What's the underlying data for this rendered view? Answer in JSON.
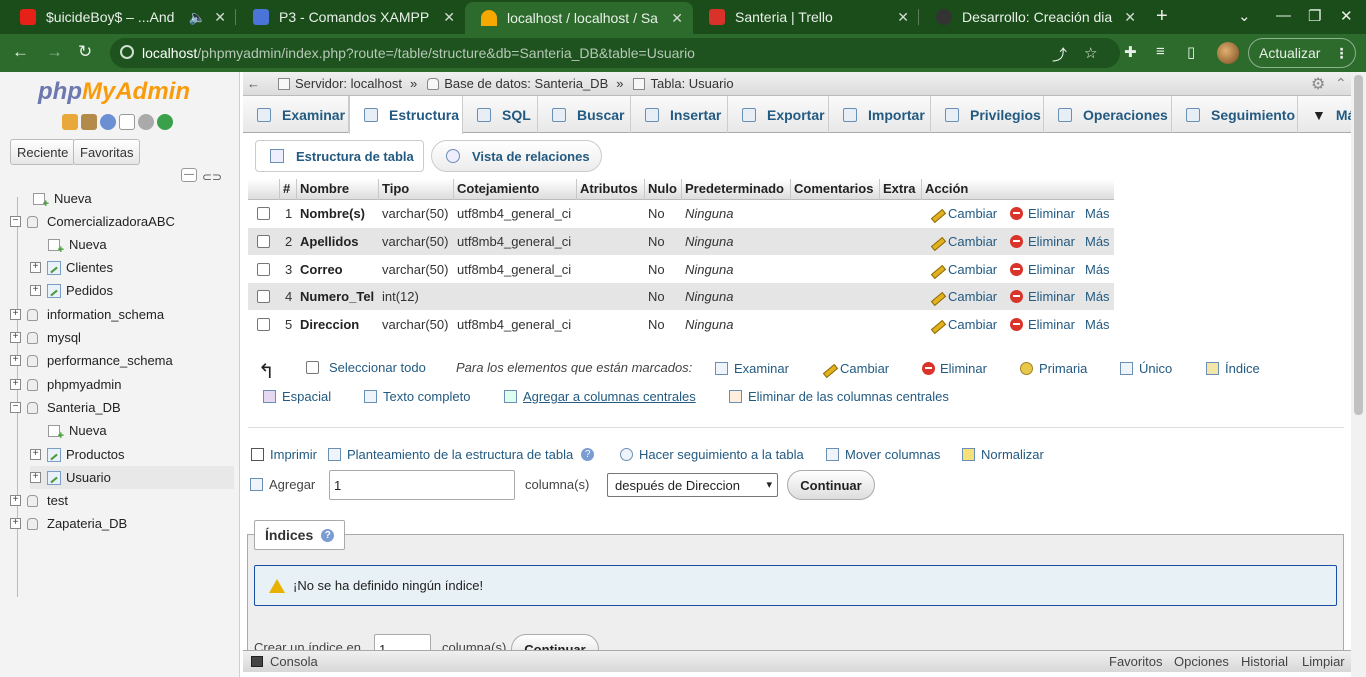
{
  "browser": {
    "tabs": [
      {
        "title": "$uicideBoy$ – ...And",
        "fav_color": "#e62117"
      },
      {
        "title": "P3 - Comandos XAMPP",
        "fav_color": "#4a74d8"
      },
      {
        "title": "localhost / localhost / Sa",
        "fav_color": "#f6a800"
      },
      {
        "title": "Santeria | Trello",
        "fav_color": "#d8322b"
      },
      {
        "title": "Desarrollo: Creación dia",
        "fav_color": "#333333"
      }
    ],
    "url_host": "localhost",
    "url_rest": "/phpmyadmin/index.php?route=/table/structure&db=Santeria_DB&table=Usuario",
    "update_label": "Actualizar"
  },
  "sidebar": {
    "logo_php": "php",
    "logo_myadmin": "MyAdmin",
    "recent_label": "Reciente",
    "favorites_label": "Favoritas",
    "tree": [
      {
        "label": "Nueva",
        "type": "new",
        "level": 0
      },
      {
        "label": "ComercializadoraABC",
        "type": "db",
        "level": 0,
        "expanded": true
      },
      {
        "label": "Nueva",
        "type": "new",
        "level": 1
      },
      {
        "label": "Clientes",
        "type": "table",
        "level": 1
      },
      {
        "label": "Pedidos",
        "type": "table",
        "level": 1
      },
      {
        "label": "information_schema",
        "type": "db",
        "level": 0
      },
      {
        "label": "mysql",
        "type": "db",
        "level": 0
      },
      {
        "label": "performance_schema",
        "type": "db",
        "level": 0
      },
      {
        "label": "phpmyadmin",
        "type": "db",
        "level": 0
      },
      {
        "label": "Santeria_DB",
        "type": "db",
        "level": 0,
        "expanded": true
      },
      {
        "label": "Nueva",
        "type": "new",
        "level": 1
      },
      {
        "label": "Productos",
        "type": "table",
        "level": 1
      },
      {
        "label": "Usuario",
        "type": "table",
        "level": 1,
        "selected": true
      },
      {
        "label": "test",
        "type": "db",
        "level": 0
      },
      {
        "label": "Zapateria_DB",
        "type": "db",
        "level": 0
      }
    ]
  },
  "breadcrumb": {
    "server": "Servidor: localhost",
    "database": "Base de datos: Santeria_DB",
    "table": "Tabla: Usuario",
    "separator": "»"
  },
  "menu_tabs": [
    "Examinar",
    "Estructura",
    "SQL",
    "Buscar",
    "Insertar",
    "Exportar",
    "Importar",
    "Privilegios",
    "Operaciones",
    "Seguimiento",
    "Más"
  ],
  "subtabs": [
    "Estructura de tabla",
    "Vista de relaciones"
  ],
  "structure": {
    "columns": [
      "#",
      "Nombre",
      "Tipo",
      "Cotejamiento",
      "Atributos",
      "Nulo",
      "Predeterminado",
      "Comentarios",
      "Extra",
      "Acción"
    ],
    "rows": [
      {
        "num": "1",
        "name": "Nombre(s)",
        "type": "varchar(50)",
        "collation": "utf8mb4_general_ci",
        "null": "No",
        "default": "Ninguna"
      },
      {
        "num": "2",
        "name": "Apellidos",
        "type": "varchar(50)",
        "collation": "utf8mb4_general_ci",
        "null": "No",
        "default": "Ninguna"
      },
      {
        "num": "3",
        "name": "Correo",
        "type": "varchar(50)",
        "collation": "utf8mb4_general_ci",
        "null": "No",
        "default": "Ninguna"
      },
      {
        "num": "4",
        "name": "Numero_Tel",
        "type": "int(12)",
        "collation": "",
        "null": "No",
        "default": "Ninguna"
      },
      {
        "num": "5",
        "name": "Direccion",
        "type": "varchar(50)",
        "collation": "utf8mb4_general_ci",
        "null": "No",
        "default": "Ninguna"
      }
    ],
    "action_change": "Cambiar",
    "action_delete": "Eliminar",
    "action_more": "Más"
  },
  "bulk": {
    "select_all": "Seleccionar todo",
    "with_selected": "Para los elementos que están marcados:",
    "browse": "Examinar",
    "change": "Cambiar",
    "delete": "Eliminar",
    "primary": "Primaria",
    "unique": "Único",
    "index": "Índice",
    "spatial": "Espacial",
    "fulltext": "Texto completo",
    "add_central": "Agregar a columnas centrales",
    "remove_central": "Eliminar de las columnas centrales"
  },
  "tools": {
    "print": "Imprimir",
    "propose": "Planteamiento de la estructura de tabla",
    "track": "Hacer seguimiento a la tabla",
    "move": "Mover columnas",
    "normalize": "Normalizar"
  },
  "add_columns": {
    "label": "Agregar",
    "value": "1",
    "unit": "columna(s)",
    "position": "después de Direccion",
    "submit": "Continuar"
  },
  "indexes": {
    "title": "Índices",
    "notice": "¡No se ha definido ningún índice!",
    "create_prefix": "Crear un índice en",
    "create_value": "1",
    "create_unit": "columna(s)",
    "create_submit": "Continuar"
  },
  "console": {
    "label": "Consola",
    "links": [
      "Favoritos",
      "Opciones",
      "Historial",
      "Limpiar"
    ]
  }
}
